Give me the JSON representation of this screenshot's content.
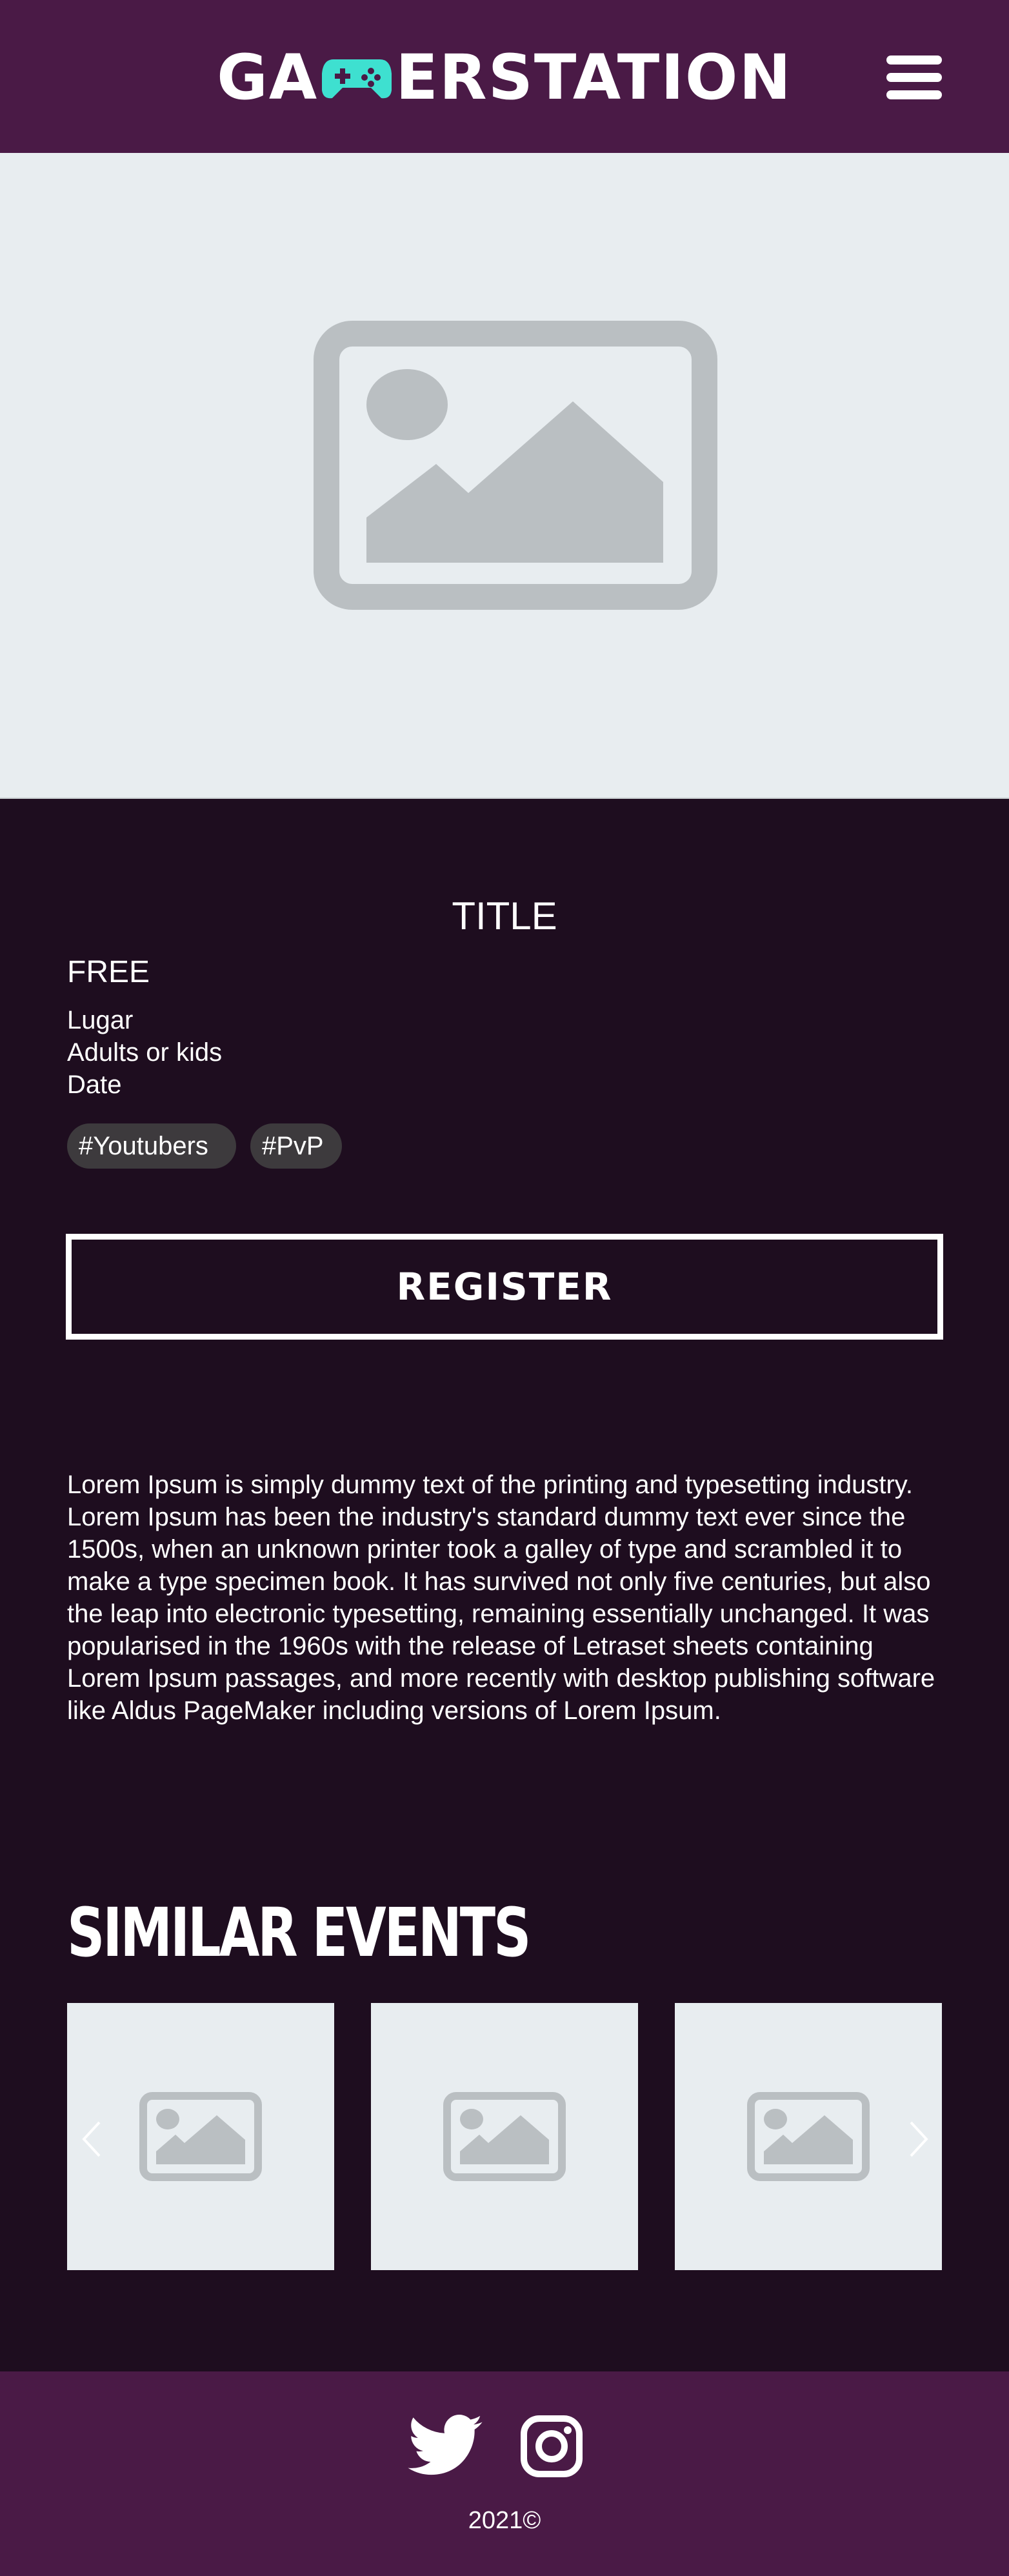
{
  "header": {
    "logo_prefix": "GA",
    "logo_suffix": "ERSTATION",
    "logo_icon": "gamepad-icon",
    "menu_icon": "hamburger-menu-icon",
    "colors": {
      "background": "#4a1a46",
      "logo_accent": "#3ee0d0"
    }
  },
  "hero": {
    "image_icon": "image-placeholder-icon"
  },
  "event": {
    "title": "TITLE",
    "price": "FREE",
    "place": "Lugar",
    "audience": "Adults or kids",
    "date": "Date",
    "tags": [
      "#Youtubers",
      "#PvP"
    ],
    "register_label": "REGISTER",
    "description": "Lorem Ipsum is simply dummy text of the printing and typesetting industry. Lorem Ipsum has been the industry's standard dummy text ever since the 1500s, when an unknown printer took a galley of type and scrambled it to make a type specimen book. It has survived not only five centuries, but also the leap into electronic typesetting, remaining essentially unchanged. It was popularised in the 1960s with the release of Letraset sheets containing Lorem Ipsum passages, and more recently with desktop publishing software like Aldus PageMaker including versions of Lorem Ipsum."
  },
  "similar_events": {
    "title": "SIMILAR EVENTS",
    "card_count_visible": 3,
    "prev_icon": "chevron-left-icon",
    "next_icon": "chevron-right-icon"
  },
  "footer": {
    "social_icons": [
      "twitter-icon",
      "instagram-icon"
    ],
    "copyright": "2021©",
    "colors": {
      "background": "#4a1a46"
    }
  },
  "colors": {
    "page_background": "#1e0d1f",
    "placeholder_bg": "#e8edf0",
    "placeholder_icon": "#babfc2",
    "tag_bg": "#3d3a3d"
  }
}
